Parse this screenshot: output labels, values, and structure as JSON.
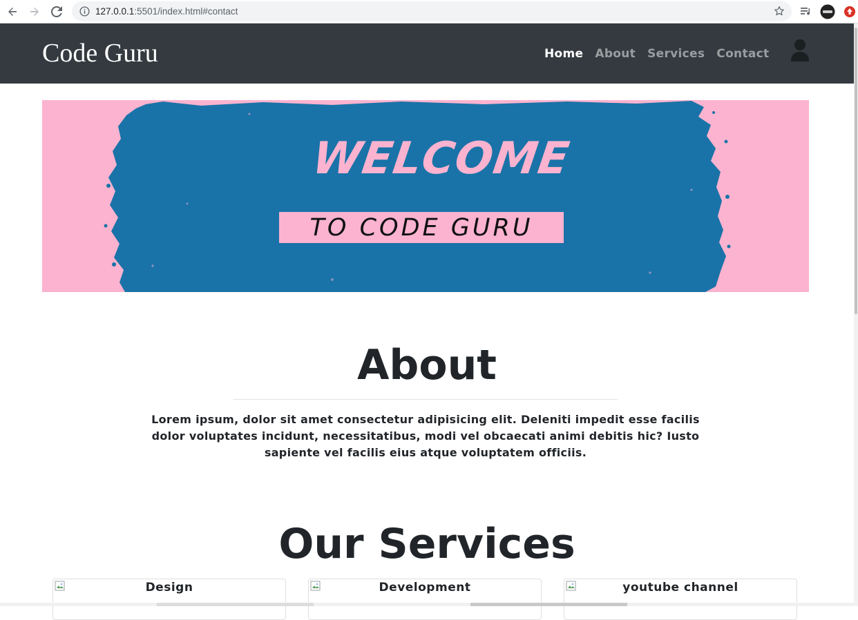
{
  "browser": {
    "url_host": "127.0.0.1",
    "url_rest": ":5501/index.html#contact"
  },
  "navbar": {
    "brand": "Code Guru",
    "items": [
      {
        "label": "Home"
      },
      {
        "label": "About"
      },
      {
        "label": "Services"
      },
      {
        "label": "Contact"
      }
    ],
    "active_item": "Home",
    "background": "#343a40"
  },
  "banner": {
    "headline": "WELCOME",
    "tagline": "TO CODE GURU",
    "pink": "#fbb3cf",
    "blue": "#1a73a8"
  },
  "about": {
    "title": "About",
    "text": "Lorem ipsum, dolor sit amet consectetur adipisicing elit. Deleniti impedit esse facilis dolor voluptates incidunt, necessitatibus, modi vel obcaecati animi debitis hic? Iusto sapiente vel facilis eius atque voluptatem officiis."
  },
  "services": {
    "title": "Our Services",
    "cards": [
      {
        "title": "Design"
      },
      {
        "title": "Development"
      },
      {
        "title": "youtube channel"
      }
    ]
  }
}
